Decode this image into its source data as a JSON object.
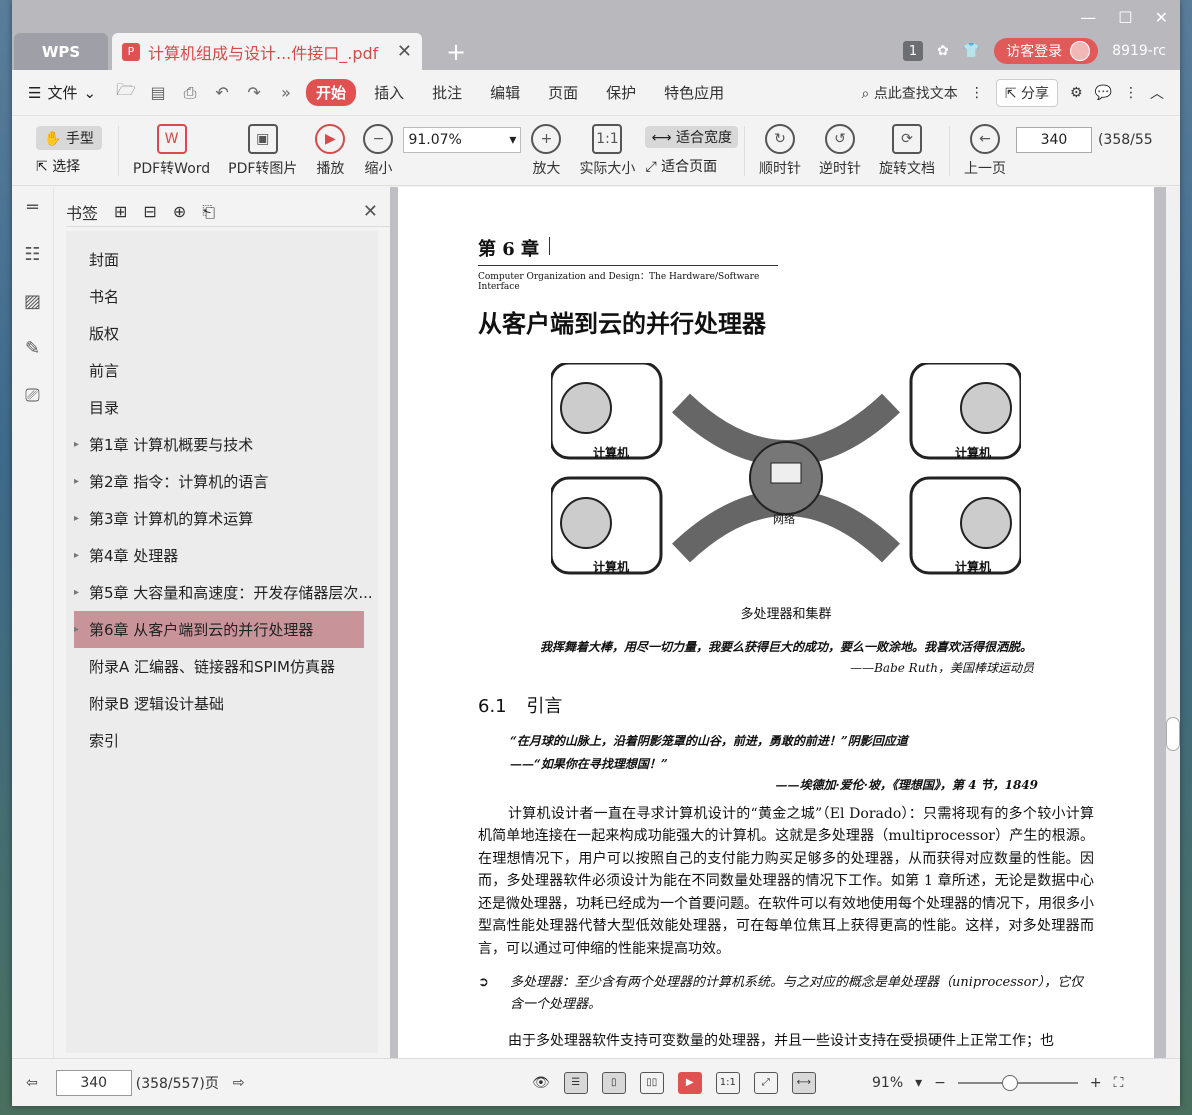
{
  "titlebar": {
    "wps_tab": "WPS",
    "doc_tab": "计算机组成与设计...件接口_.pdf",
    "badge_count": "1",
    "login_label": "访客登录",
    "user_label": "8919-rc"
  },
  "menubar": {
    "file_label": "文件",
    "items": [
      "开始",
      "插入",
      "批注",
      "编辑",
      "页面",
      "保护",
      "特色应用"
    ],
    "active_index": 0,
    "search_label": "点此查找文本",
    "share_label": "分享"
  },
  "toolbar": {
    "hand": "手型",
    "select": "选择",
    "pdf_to_word": "PDF转Word",
    "pdf_to_image": "PDF转图片",
    "play": "播放",
    "zoom_out": "缩小",
    "zoom_value": "91.07%",
    "zoom_in": "放大",
    "actual_size": "实际大小",
    "fit_width": "适合宽度",
    "fit_page": "适合页面",
    "rotate_cw": "顺时针",
    "rotate_ccw": "逆时针",
    "rotate_doc": "旋转文档",
    "prev_page": "上一页",
    "page_current": "340",
    "page_total": "(358/55"
  },
  "bookmarks": {
    "title": "书签",
    "items": [
      {
        "label": "封面",
        "children": false
      },
      {
        "label": "书名",
        "children": false
      },
      {
        "label": "版权",
        "children": false
      },
      {
        "label": "前言",
        "children": false
      },
      {
        "label": "目录",
        "children": false
      },
      {
        "label": "第1章  计算机概要与技术",
        "children": true
      },
      {
        "label": "第2章  指令：计算机的语言",
        "children": true
      },
      {
        "label": "第3章  计算机的算术运算",
        "children": true
      },
      {
        "label": "第4章  处理器",
        "children": true
      },
      {
        "label": "第5章  大容量和高速度：开发存储器层次...",
        "children": true
      },
      {
        "label": "第6章  从客户端到云的并行处理器",
        "children": true
      },
      {
        "label": "附录A  汇编器、链接器和SPIM仿真器",
        "children": false
      },
      {
        "label": "附录B  逻辑设计基础",
        "children": false
      },
      {
        "label": "索引",
        "children": false
      }
    ],
    "selected_index": 10
  },
  "page": {
    "chapter": "第 6 章",
    "subtitle": "Computer Organization and Design：The Hardware/Software Interface",
    "title": "从客户端到云的并行处理器",
    "figure_labels": {
      "computer": "计算机",
      "network": "网络"
    },
    "figure_caption": "多处理器和集群",
    "quote1": "我挥舞着大棒，用尽一切力量，我要么获得巨大的成功，要么一败涂地。我喜欢活得很洒脱。",
    "attrib1": "——Babe Ruth，美国棒球运动员",
    "section_num": "6.1",
    "section_title": "引言",
    "quote2_line1": "“在月球的山脉上，沿着阴影笼罩的山谷，前进，勇敢的前进！”阴影回应道",
    "quote2_line2": "——“如果你在寻找理想国！”",
    "attrib2": "——埃德加·爱伦·坡，《理想国》，第 4 节，1849",
    "para1": "计算机设计者一直在寻求计算机设计的“黄金之城”（El Dorado）：只需将现有的多个较小计算机简单地连接在一起来构成功能强大的计算机。这就是多处理器（multiprocessor）产生的根源。在理想情况下，用户可以按照自己的支付能力购买足够多的处理器，从而获得对应数量的性能。因而，多处理器软件必须设计为能在不同数量处理器的情况下工作。如第 1 章所述，无论是数据中心还是微处理器，功耗已经成为一个首要问题。在软件可以有效地使用每个处理器的情况下，用很多小型高性能处理器代替大型低效能处理器，可在每单位焦耳上获得更高的性能。这样，对多处理器而言，可以通过可伸缩的性能来提高功效。",
    "definition": "多处理器：至少含有两个处理器的计算机系统。与之对应的概念是单处理器（uniprocessor），它仅含一个处理器。",
    "para2": "由于多处理器软件支持可变数量的处理器，并且一些设计支持在受损硬件上正常工作；也"
  },
  "statusbar": {
    "page_current": "340",
    "page_total": "(358/557)页",
    "zoom": "91%"
  },
  "colors": {
    "accent": "#e05252",
    "selected_bookmark": "#c8949a"
  }
}
